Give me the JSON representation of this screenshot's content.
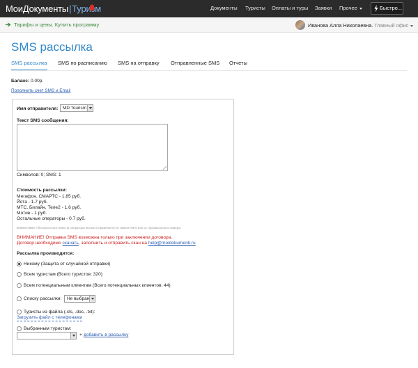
{
  "topnav": {
    "logo_main": "МоиДокументы",
    "logo_sep": "|",
    "logo_suffix": "Туризм",
    "items": [
      {
        "label": "Документы"
      },
      {
        "label": "Туристы"
      },
      {
        "label": "Оплаты и туры"
      },
      {
        "label": "Заявки"
      },
      {
        "label": "Прочее"
      }
    ],
    "quick_label": "Быстро...",
    "bell_icon": "bell-icon",
    "bolt_icon": "lightning-icon",
    "bg_color": "#2b2b2b"
  },
  "subbar": {
    "tariff_link": "Тарифы и цены. Купить программу",
    "user_name": "Иванова Алла Николаевна.",
    "user_office": "Главный офис"
  },
  "page": {
    "title": "SMS рассылка",
    "tabs": [
      {
        "label": "SMS рассылка",
        "active": true
      },
      {
        "label": "SMS по расписанию",
        "active": false
      },
      {
        "label": "SMS на отправку",
        "active": false
      },
      {
        "label": "Отправленные SMS",
        "active": false
      },
      {
        "label": "Отчеты",
        "active": false
      }
    ],
    "balance_label": "Баланс:",
    "balance_value": "0.00р.",
    "topup_link": "Пополнить счет SMS и Email",
    "accent_color": "#2f86c9"
  },
  "form": {
    "sender_label": "Имя отправителя:",
    "sender_value": "MD Tourism",
    "sms_text_label": "Текст SMS сообщения:",
    "sms_text_value": "",
    "counter": "Символов: 0; SMS: 1",
    "cost_title": "Стоимость рассылки:",
    "cost_lines": [
      "Мегафон, СМАРТС - 1.85 руб.",
      "Йота - 1.7 руб.",
      "МТС, Билайн, Теле2 - 1.6 руб.",
      "Мотив - 1 руб.",
      "Остальные операторы - 0.7 руб."
    ],
    "note": "ВНИМАНИЕ! Абсолютно все SMS на оператора Мотив отправляются от имени INFO или от произвольного номера.",
    "warning_line1": "ВНИМАНИЕ! Отправка SMS возможна только при заключении договора.",
    "warning_line2_a": "Договор необходимо",
    "warning_line2_link": "скачать",
    "warning_line2_b": ", заполнить и отправить скан на",
    "warning_email": "help@moidokumenti.ru",
    "recipients_title": "Рассылка производится:",
    "options": [
      {
        "label": "Никому (Защита от случайной отправки)",
        "checked": true
      },
      {
        "label": "Всем туристам (Всего туристов: 320)",
        "checked": false
      },
      {
        "label": "Всем потенциальным клиентам (Всего потенциальных клиентов: 44)",
        "checked": false
      },
      {
        "label": "Списку рассылки:",
        "checked": false
      },
      {
        "label": "Туристы из файла (.xls, .doc, .txt):",
        "checked": false
      },
      {
        "label": "Выбранным туристам:",
        "checked": false
      }
    ],
    "list_select_value": "Не выбран",
    "upload_link": "Загрузить файл с телефонами",
    "tourists_select_value": "",
    "plus_sign": "+",
    "add_link": "добавить в рассылку"
  }
}
